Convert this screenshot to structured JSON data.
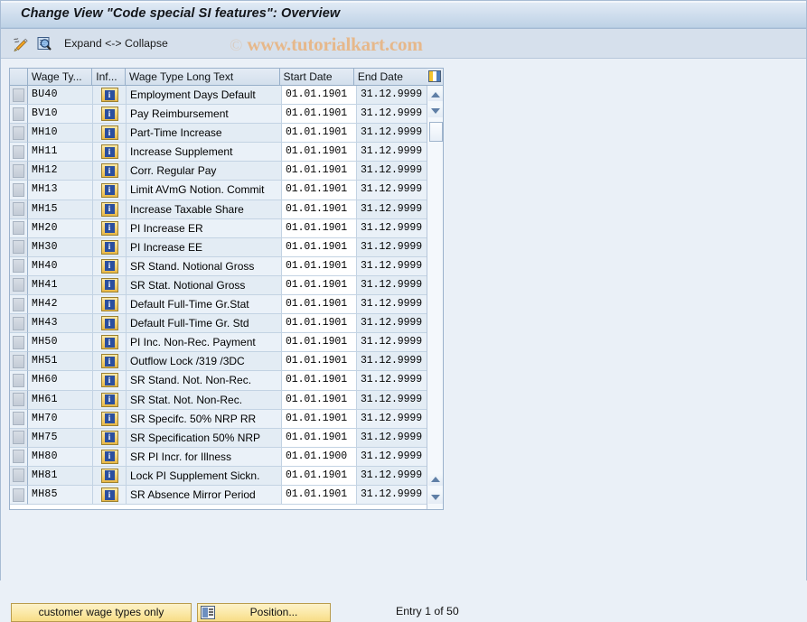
{
  "window": {
    "title": "Change View \"Code special SI features\": Overview"
  },
  "toolbar": {
    "icons": [
      {
        "name": "edit-pencil-icon",
        "glyph": "edit"
      },
      {
        "name": "search-document-icon",
        "glyph": "search-doc"
      }
    ],
    "expand_collapse_label": "Expand <-> Collapse"
  },
  "watermark": {
    "copyright": "©",
    "text": "www.tutorialkart.com",
    "color": "#e8b583"
  },
  "table": {
    "columns": [
      {
        "key": "select",
        "label": ""
      },
      {
        "key": "wage_type",
        "label": "Wage Ty..."
      },
      {
        "key": "info",
        "label": "Inf..."
      },
      {
        "key": "long_text",
        "label": "Wage Type Long Text"
      },
      {
        "key": "start_date",
        "label": "Start Date"
      },
      {
        "key": "end_date",
        "label": "End Date"
      }
    ],
    "config_icon": "column-config-icon",
    "rows": [
      {
        "wage_type": "BU40",
        "long_text": "Employment Days Default",
        "start_date": "01.01.1901",
        "end_date": "31.12.9999"
      },
      {
        "wage_type": "BV10",
        "long_text": "Pay Reimbursement",
        "start_date": "01.01.1901",
        "end_date": "31.12.9999"
      },
      {
        "wage_type": "MH10",
        "long_text": "Part-Time Increase",
        "start_date": "01.01.1901",
        "end_date": "31.12.9999"
      },
      {
        "wage_type": "MH11",
        "long_text": "Increase Supplement",
        "start_date": "01.01.1901",
        "end_date": "31.12.9999"
      },
      {
        "wage_type": "MH12",
        "long_text": "Corr. Regular Pay",
        "start_date": "01.01.1901",
        "end_date": "31.12.9999"
      },
      {
        "wage_type": "MH13",
        "long_text": "Limit AVmG Notion. Commit",
        "start_date": "01.01.1901",
        "end_date": "31.12.9999"
      },
      {
        "wage_type": "MH15",
        "long_text": "Increase Taxable Share",
        "start_date": "01.01.1901",
        "end_date": "31.12.9999"
      },
      {
        "wage_type": "MH20",
        "long_text": "PI Increase ER",
        "start_date": "01.01.1901",
        "end_date": "31.12.9999"
      },
      {
        "wage_type": "MH30",
        "long_text": "PI Increase EE",
        "start_date": "01.01.1901",
        "end_date": "31.12.9999"
      },
      {
        "wage_type": "MH40",
        "long_text": "SR Stand. Notional Gross",
        "start_date": "01.01.1901",
        "end_date": "31.12.9999"
      },
      {
        "wage_type": "MH41",
        "long_text": "SR Stat. Notional Gross",
        "start_date": "01.01.1901",
        "end_date": "31.12.9999"
      },
      {
        "wage_type": "MH42",
        "long_text": "Default Full-Time Gr.Stat",
        "start_date": "01.01.1901",
        "end_date": "31.12.9999"
      },
      {
        "wage_type": "MH43",
        "long_text": "Default Full-Time Gr. Std",
        "start_date": "01.01.1901",
        "end_date": "31.12.9999"
      },
      {
        "wage_type": "MH50",
        "long_text": "PI Inc. Non-Rec. Payment",
        "start_date": "01.01.1901",
        "end_date": "31.12.9999"
      },
      {
        "wage_type": "MH51",
        "long_text": "Outflow Lock /319 /3DC",
        "start_date": "01.01.1901",
        "end_date": "31.12.9999"
      },
      {
        "wage_type": "MH60",
        "long_text": "SR Stand. Not. Non-Rec.",
        "start_date": "01.01.1901",
        "end_date": "31.12.9999"
      },
      {
        "wage_type": "MH61",
        "long_text": "SR Stat. Not. Non-Rec.",
        "start_date": "01.01.1901",
        "end_date": "31.12.9999"
      },
      {
        "wage_type": "MH70",
        "long_text": "SR Specifc. 50% NRP RR",
        "start_date": "01.01.1901",
        "end_date": "31.12.9999"
      },
      {
        "wage_type": "MH75",
        "long_text": "SR Specification 50% NRP",
        "start_date": "01.01.1901",
        "end_date": "31.12.9999"
      },
      {
        "wage_type": "MH80",
        "long_text": "SR PI Incr. for Illness",
        "start_date": "01.01.1900",
        "end_date": "31.12.9999"
      },
      {
        "wage_type": "MH81",
        "long_text": "Lock PI Supplement Sickn.",
        "start_date": "01.01.1901",
        "end_date": "31.12.9999"
      },
      {
        "wage_type": "MH85",
        "long_text": "SR Absence Mirror Period",
        "start_date": "01.01.1901",
        "end_date": "31.12.9999"
      }
    ]
  },
  "footer": {
    "customer_wage_types_label": "customer wage types only",
    "position_label": "Position...",
    "entry_status": "Entry 1 of 50"
  }
}
